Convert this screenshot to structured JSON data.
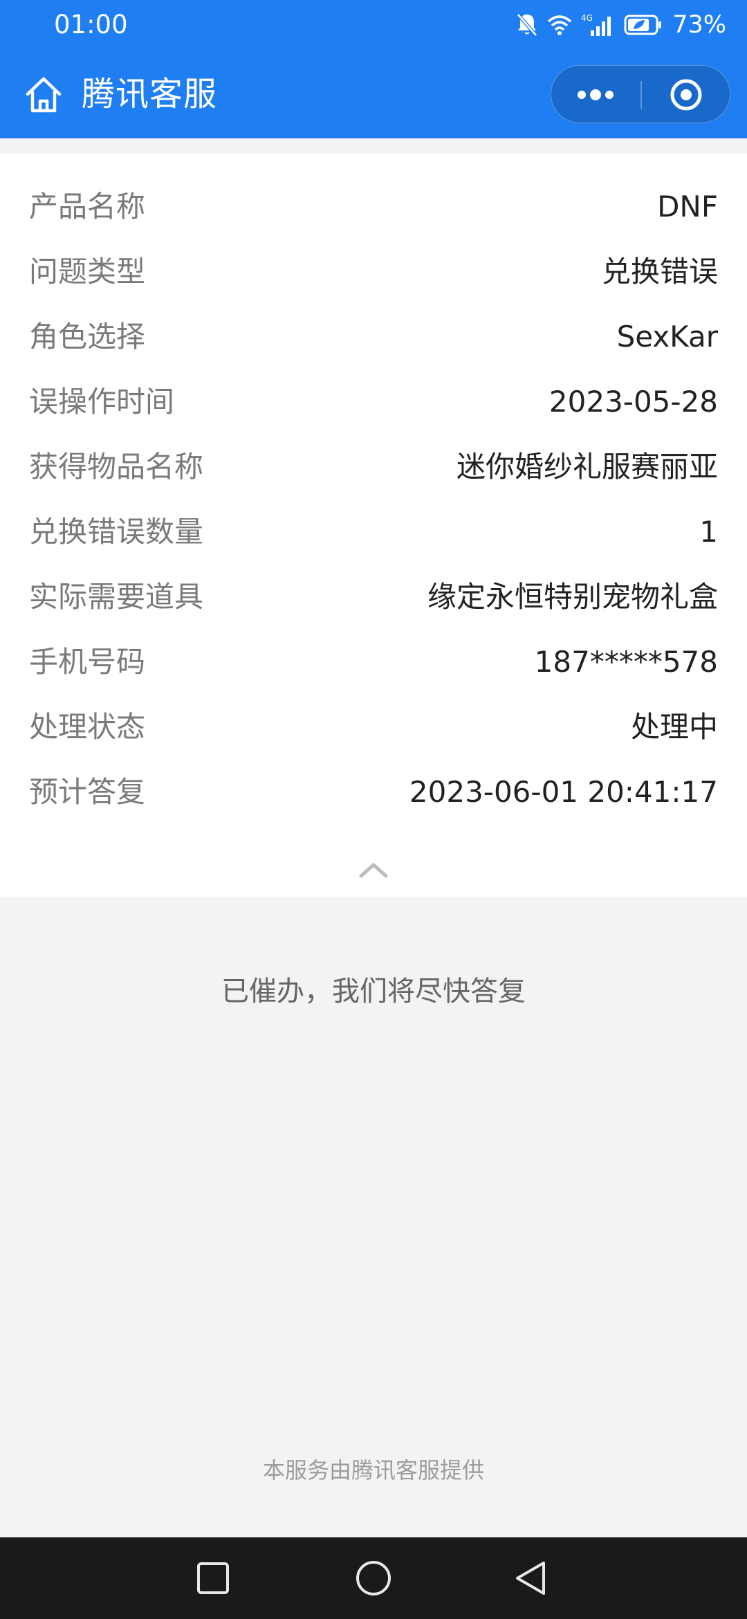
{
  "status_bar": {
    "time": "01:00",
    "network": "4G",
    "battery": "73%",
    "icons": [
      "bell-muted-icon",
      "wifi-icon",
      "signal-icon",
      "battery-saver-icon"
    ]
  },
  "nav": {
    "title": "腾讯客服",
    "icons": [
      "home-icon",
      "more-icon",
      "close-mini-program-icon"
    ]
  },
  "details": [
    {
      "label": "产品名称",
      "value": "DNF"
    },
    {
      "label": "问题类型",
      "value": "兑换错误"
    },
    {
      "label": "角色选择",
      "value": "SexKar"
    },
    {
      "label": "误操作时间",
      "value": "2023-05-28"
    },
    {
      "label": "获得物品名称",
      "value": "迷你婚纱礼服赛丽亚"
    },
    {
      "label": "兑换错误数量",
      "value": "1"
    },
    {
      "label": "实际需要道具",
      "value": "缘定永恒特别宠物礼盒"
    },
    {
      "label": "手机号码",
      "value": "187*****578"
    },
    {
      "label": "处理状态",
      "value": "处理中"
    },
    {
      "label": "预计答复",
      "value": "2023-06-01 20:41:17"
    }
  ],
  "notice": "已催办，我们将尽快答复",
  "footer": "本服务由腾讯客服提供",
  "colors": {
    "header_blue": "#1e7ef2",
    "page_bg": "#f3f3f3",
    "system_nav_bg": "#1a1a1a"
  }
}
